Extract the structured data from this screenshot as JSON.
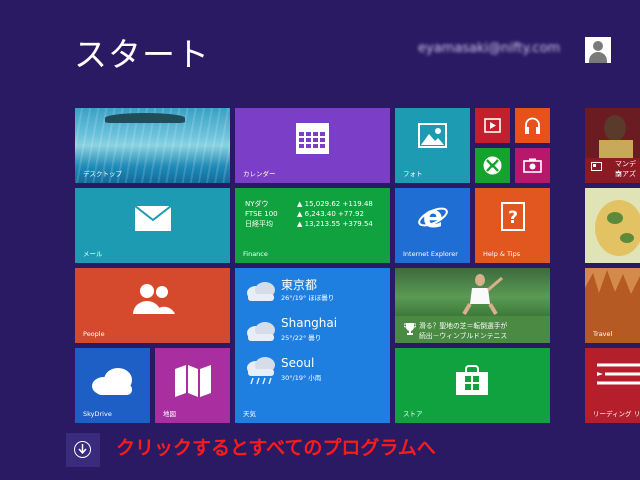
{
  "header": {
    "title": "スタート",
    "user_name": "eyamasaki@nifty.com"
  },
  "tiles": {
    "desktop": {
      "label": "デスクトップ",
      "icon": "desktop-landscape-image"
    },
    "calendar": {
      "label": "カレンダー",
      "icon": "calendar-icon"
    },
    "photos": {
      "label": "フォト",
      "icon": "photo-icon"
    },
    "video": {
      "icon": "video-icon"
    },
    "music": {
      "icon": "headphones-icon"
    },
    "games": {
      "icon": "game-controller-icon"
    },
    "camera": {
      "icon": "camera-icon"
    },
    "mail": {
      "label": "メール",
      "icon": "envelope-icon"
    },
    "finance": {
      "label": "Finance",
      "rows": [
        {
          "name": "NYダウ",
          "arrow": "▲",
          "value": "15,029.62",
          "change": "+119.48"
        },
        {
          "name": "FTSE 100",
          "arrow": "▲",
          "value": "6,243.40",
          "change": "+77.92"
        },
        {
          "name": "日経平均",
          "arrow": "▲",
          "value": "13,213.55",
          "change": "+379.54"
        }
      ]
    },
    "ie": {
      "label": "Internet Explorer",
      "icon": "internet-explorer-icon"
    },
    "help": {
      "label": "Help & Tips",
      "icon": "help-book-icon"
    },
    "people": {
      "label": "People",
      "icon": "people-icon"
    },
    "weather": {
      "label": "天気",
      "cities": [
        {
          "name": "東京都",
          "temp": "26°/19° ほぼ曇り"
        },
        {
          "name": "Shanghai",
          "temp": "25°/22° 曇り"
        },
        {
          "name": "Seoul",
          "temp": "30°/19° 小雨"
        }
      ]
    },
    "sport": {
      "line1": "滑る？聖地の芝＝転倒選手が",
      "line2": "続出－ウィンブルドンテニス",
      "icon": "trophy-icon"
    },
    "skydrive": {
      "label": "SkyDrive",
      "icon": "cloud-icon"
    },
    "maps": {
      "label": "地図",
      "icon": "map-icon"
    },
    "store": {
      "label": "ストア",
      "icon": "store-bag-icon"
    },
    "news": {
      "line1": "マンデラ",
      "line2": "南アズ"
    },
    "food": {},
    "travel": {
      "label": "Travel"
    },
    "reading": {
      "label": "リーディング リスト"
    }
  },
  "footer": {
    "all_apps_icon": "down-arrow-circle-icon",
    "annotation": "クリックするとすべてのプログラムへ",
    "annotation_color": "#ff1a1a"
  },
  "colors": {
    "background": "#2a1a63"
  }
}
